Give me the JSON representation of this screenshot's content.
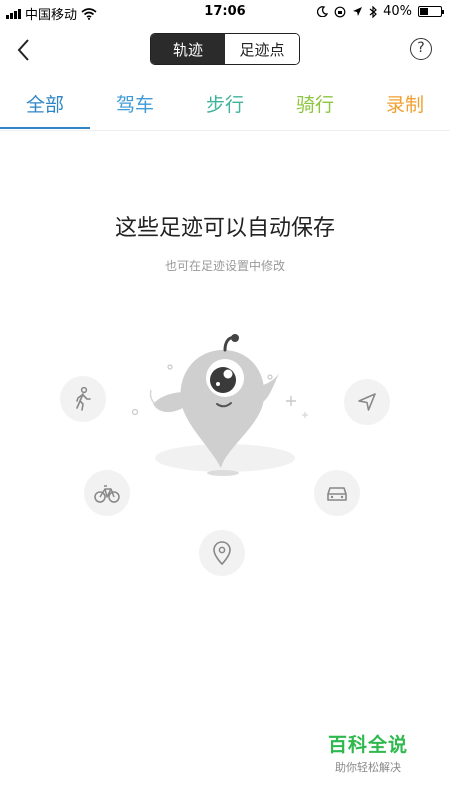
{
  "status_bar": {
    "carrier": "中国移动",
    "time": "17:06",
    "battery": "40%",
    "battery_level": 0.4
  },
  "nav": {
    "segments": [
      "轨迹",
      "足迹点"
    ],
    "help": "?"
  },
  "tabs": [
    {
      "label": "全部",
      "color": "#2f86c7"
    },
    {
      "label": "驾车",
      "color": "#3f9ad6"
    },
    {
      "label": "步行",
      "color": "#3fb39a"
    },
    {
      "label": "骑行",
      "color": "#8cc63f"
    },
    {
      "label": "录制",
      "color": "#f0a030"
    }
  ],
  "empty_state": {
    "title": "这些足迹可以自动保存",
    "subtitle": "也可在足迹设置中修改",
    "icons": [
      "walk-icon",
      "navigate-icon",
      "bicycle-icon",
      "car-icon",
      "location-pin-icon"
    ]
  },
  "watermark": {
    "title": "百科全说",
    "subtitle": "助你轻松解决"
  }
}
